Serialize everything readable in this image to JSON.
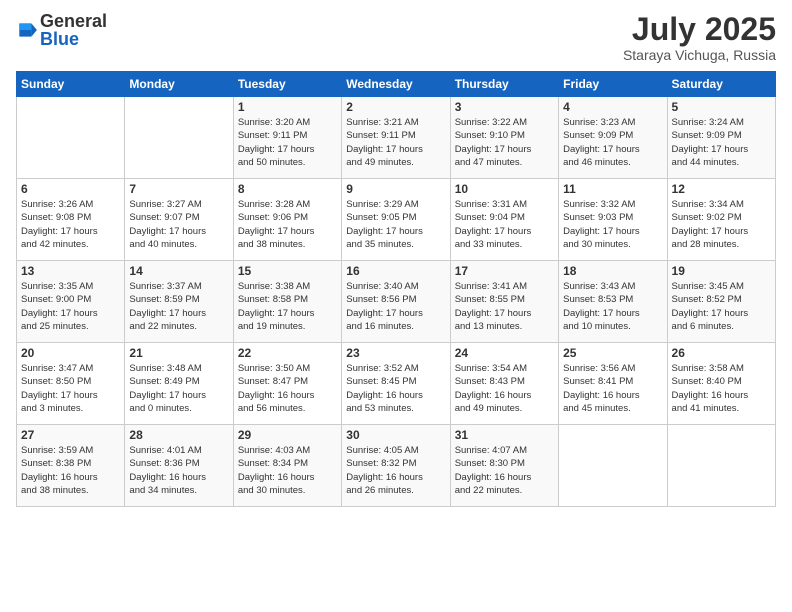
{
  "logo": {
    "general": "General",
    "blue": "Blue"
  },
  "title": "July 2025",
  "location": "Staraya Vichuga, Russia",
  "headers": [
    "Sunday",
    "Monday",
    "Tuesday",
    "Wednesday",
    "Thursday",
    "Friday",
    "Saturday"
  ],
  "weeks": [
    [
      {
        "day": "",
        "info": ""
      },
      {
        "day": "",
        "info": ""
      },
      {
        "day": "1",
        "info": "Sunrise: 3:20 AM\nSunset: 9:11 PM\nDaylight: 17 hours\nand 50 minutes."
      },
      {
        "day": "2",
        "info": "Sunrise: 3:21 AM\nSunset: 9:11 PM\nDaylight: 17 hours\nand 49 minutes."
      },
      {
        "day": "3",
        "info": "Sunrise: 3:22 AM\nSunset: 9:10 PM\nDaylight: 17 hours\nand 47 minutes."
      },
      {
        "day": "4",
        "info": "Sunrise: 3:23 AM\nSunset: 9:09 PM\nDaylight: 17 hours\nand 46 minutes."
      },
      {
        "day": "5",
        "info": "Sunrise: 3:24 AM\nSunset: 9:09 PM\nDaylight: 17 hours\nand 44 minutes."
      }
    ],
    [
      {
        "day": "6",
        "info": "Sunrise: 3:26 AM\nSunset: 9:08 PM\nDaylight: 17 hours\nand 42 minutes."
      },
      {
        "day": "7",
        "info": "Sunrise: 3:27 AM\nSunset: 9:07 PM\nDaylight: 17 hours\nand 40 minutes."
      },
      {
        "day": "8",
        "info": "Sunrise: 3:28 AM\nSunset: 9:06 PM\nDaylight: 17 hours\nand 38 minutes."
      },
      {
        "day": "9",
        "info": "Sunrise: 3:29 AM\nSunset: 9:05 PM\nDaylight: 17 hours\nand 35 minutes."
      },
      {
        "day": "10",
        "info": "Sunrise: 3:31 AM\nSunset: 9:04 PM\nDaylight: 17 hours\nand 33 minutes."
      },
      {
        "day": "11",
        "info": "Sunrise: 3:32 AM\nSunset: 9:03 PM\nDaylight: 17 hours\nand 30 minutes."
      },
      {
        "day": "12",
        "info": "Sunrise: 3:34 AM\nSunset: 9:02 PM\nDaylight: 17 hours\nand 28 minutes."
      }
    ],
    [
      {
        "day": "13",
        "info": "Sunrise: 3:35 AM\nSunset: 9:00 PM\nDaylight: 17 hours\nand 25 minutes."
      },
      {
        "day": "14",
        "info": "Sunrise: 3:37 AM\nSunset: 8:59 PM\nDaylight: 17 hours\nand 22 minutes."
      },
      {
        "day": "15",
        "info": "Sunrise: 3:38 AM\nSunset: 8:58 PM\nDaylight: 17 hours\nand 19 minutes."
      },
      {
        "day": "16",
        "info": "Sunrise: 3:40 AM\nSunset: 8:56 PM\nDaylight: 17 hours\nand 16 minutes."
      },
      {
        "day": "17",
        "info": "Sunrise: 3:41 AM\nSunset: 8:55 PM\nDaylight: 17 hours\nand 13 minutes."
      },
      {
        "day": "18",
        "info": "Sunrise: 3:43 AM\nSunset: 8:53 PM\nDaylight: 17 hours\nand 10 minutes."
      },
      {
        "day": "19",
        "info": "Sunrise: 3:45 AM\nSunset: 8:52 PM\nDaylight: 17 hours\nand 6 minutes."
      }
    ],
    [
      {
        "day": "20",
        "info": "Sunrise: 3:47 AM\nSunset: 8:50 PM\nDaylight: 17 hours\nand 3 minutes."
      },
      {
        "day": "21",
        "info": "Sunrise: 3:48 AM\nSunset: 8:49 PM\nDaylight: 17 hours\nand 0 minutes."
      },
      {
        "day": "22",
        "info": "Sunrise: 3:50 AM\nSunset: 8:47 PM\nDaylight: 16 hours\nand 56 minutes."
      },
      {
        "day": "23",
        "info": "Sunrise: 3:52 AM\nSunset: 8:45 PM\nDaylight: 16 hours\nand 53 minutes."
      },
      {
        "day": "24",
        "info": "Sunrise: 3:54 AM\nSunset: 8:43 PM\nDaylight: 16 hours\nand 49 minutes."
      },
      {
        "day": "25",
        "info": "Sunrise: 3:56 AM\nSunset: 8:41 PM\nDaylight: 16 hours\nand 45 minutes."
      },
      {
        "day": "26",
        "info": "Sunrise: 3:58 AM\nSunset: 8:40 PM\nDaylight: 16 hours\nand 41 minutes."
      }
    ],
    [
      {
        "day": "27",
        "info": "Sunrise: 3:59 AM\nSunset: 8:38 PM\nDaylight: 16 hours\nand 38 minutes."
      },
      {
        "day": "28",
        "info": "Sunrise: 4:01 AM\nSunset: 8:36 PM\nDaylight: 16 hours\nand 34 minutes."
      },
      {
        "day": "29",
        "info": "Sunrise: 4:03 AM\nSunset: 8:34 PM\nDaylight: 16 hours\nand 30 minutes."
      },
      {
        "day": "30",
        "info": "Sunrise: 4:05 AM\nSunset: 8:32 PM\nDaylight: 16 hours\nand 26 minutes."
      },
      {
        "day": "31",
        "info": "Sunrise: 4:07 AM\nSunset: 8:30 PM\nDaylight: 16 hours\nand 22 minutes."
      },
      {
        "day": "",
        "info": ""
      },
      {
        "day": "",
        "info": ""
      }
    ]
  ]
}
